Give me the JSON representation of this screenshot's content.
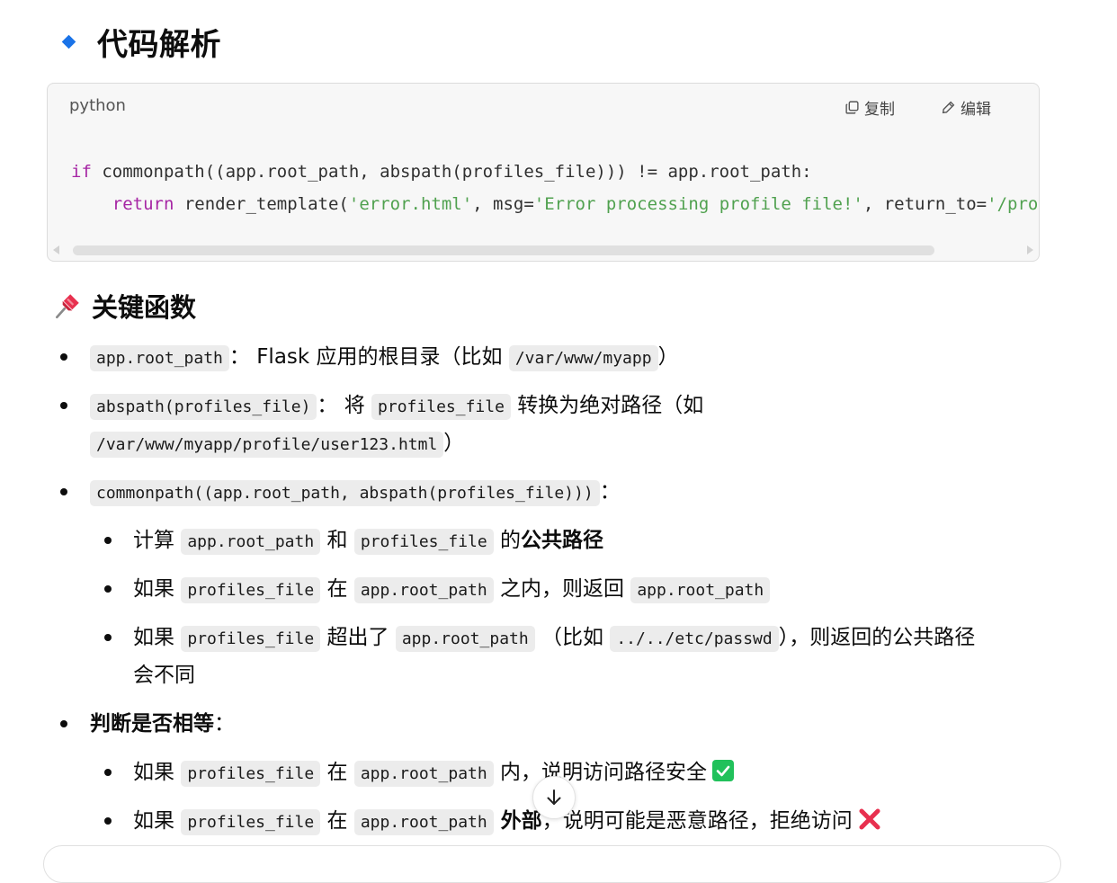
{
  "section": {
    "title": "代码解析",
    "diamond_color": "#1a73e8"
  },
  "code_block": {
    "language": "python",
    "copy_label": "复制",
    "edit_label": "编辑",
    "line1": {
      "kw": "if",
      "rest": " commonpath((app.root_path, abspath(profiles_file))) != app.root_path:"
    },
    "line2": {
      "indent": "    ",
      "kw": "return",
      "part1": " render_template(",
      "str1": "'error.html'",
      "part2": ", msg=",
      "str2": "'Error processing profile file!'",
      "part3": ", return_to=",
      "str3": "'/pro"
    }
  },
  "subsection": {
    "icon": "pushpin-icon",
    "title": "关键函数"
  },
  "items": {
    "i1": {
      "code": "app.root_path",
      "text1": "： Flask 应用的根目录（比如 ",
      "code2": "/var/www/myapp",
      "text2": "）"
    },
    "i2": {
      "code": "abspath(profiles_file)",
      "text1": "： 将 ",
      "code2": "profiles_file",
      "text2": " 转换为绝对路径（如",
      "code3": "/var/www/myapp/profile/user123.html",
      "text3": "）"
    },
    "i3": {
      "code": "commonpath((app.root_path, abspath(profiles_file)))",
      "text1": "："
    },
    "i3a": {
      "t1": "计算 ",
      "c1": "app.root_path",
      "t2": " 和 ",
      "c2": "profiles_file",
      "t3": " 的",
      "bold": "公共路径"
    },
    "i3b": {
      "t1": "如果 ",
      "c1": "profiles_file",
      "t2": " 在 ",
      "c2": "app.root_path",
      "t3": " 之内，则返回 ",
      "c3": "app.root_path"
    },
    "i3c": {
      "t1": "如果 ",
      "c1": "profiles_file",
      "t2": " 超出了 ",
      "c2": "app.root_path",
      "t3": " （比如 ",
      "c3": "../../etc/passwd",
      "t4": "），则返回的公共路径",
      "t5": "会不同"
    },
    "i4": {
      "bold": "判断是否相等",
      "text1": "："
    },
    "i4a": {
      "t1": "如果 ",
      "c1": "profiles_file",
      "t2": " 在 ",
      "c2": "app.root_path",
      "t3": " 内，说明访问路径安全",
      "icon": "check-mark-icon",
      "icon_color": "#21c15b"
    },
    "i4b": {
      "t1": "如果 ",
      "c1": "profiles_file",
      "t2": " 在 ",
      "c2": "app.root_path",
      "bold": " 外部",
      "t3": "，说明可能是恶意路径，拒绝访问",
      "icon": "cross-mark-icon",
      "icon_color": "#e8304f"
    }
  }
}
